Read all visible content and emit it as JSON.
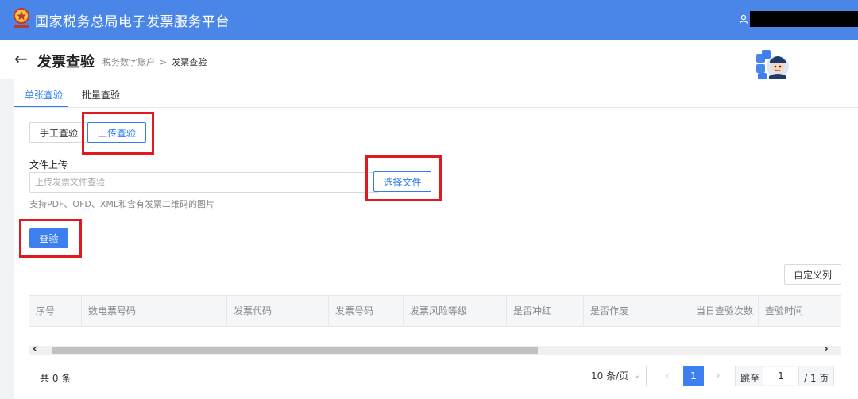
{
  "app": {
    "title": "国家税务总局电子发票服务平台"
  },
  "header": {
    "page_title": "发票查验",
    "breadcrumb": [
      "税务数字账户",
      "发票查验"
    ],
    "breadcrumb_sep": ">"
  },
  "tabs": [
    {
      "label": "单张查验",
      "active": true
    },
    {
      "label": "批量查验",
      "active": false
    }
  ],
  "mode_buttons": [
    {
      "label": "手工查验",
      "active": false
    },
    {
      "label": "上传查验",
      "active": true
    }
  ],
  "upload": {
    "label": "文件上传",
    "placeholder": "上传发票文件查验",
    "select_button": "选择文件",
    "hint": "支持PDF、OFD、XML和含有发票二维码的图片"
  },
  "check_button": "查验",
  "custom_columns_button": "自定义列",
  "table": {
    "columns": [
      "序号",
      "数电票号码",
      "发票代码",
      "发票号码",
      "发票风险等级",
      "是否冲红",
      "是否作废",
      "当日查验次数",
      "查验时间"
    ],
    "rows": []
  },
  "pagination": {
    "total_text": "共 0 条",
    "page_size": "10 条/页",
    "current_page": "1",
    "jump_label": "跳至",
    "jump_value": "1",
    "total_pages": "/ 1 页"
  },
  "colors": {
    "topbar": "#4a86e8",
    "accent": "#2f7cf6",
    "primary_button": "#3d7fef",
    "highlight": "#e0191f"
  }
}
